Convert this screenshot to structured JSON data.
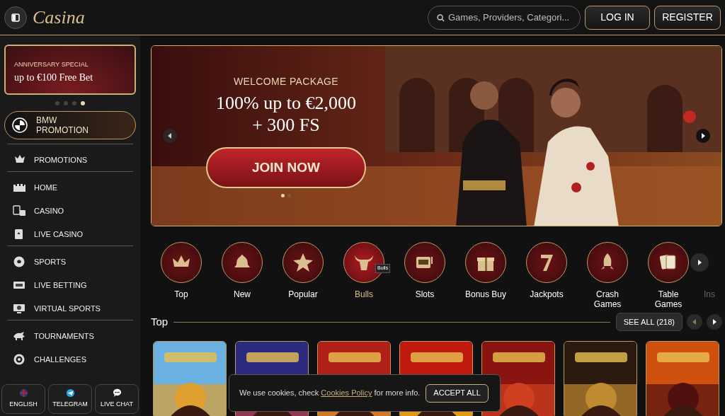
{
  "header": {
    "logo": "Casina",
    "search": {
      "placeholder": "Games, Providers, Categori..."
    },
    "buttons": [
      "LOG IN",
      "REGISTER"
    ]
  },
  "sidebar": {
    "promo": {
      "eyebrow": "ANNIVERSARY SPECIAL",
      "title": "up to €100 Free Bet"
    },
    "promo_dots": [
      {
        "selected": false
      },
      {
        "selected": false
      },
      {
        "selected": false
      },
      {
        "selected": true
      }
    ],
    "bmw": {
      "line_1": "BMW",
      "line_2": "PROMOTION"
    },
    "groups": [
      [
        {
          "label": "PROMOTIONS"
        }
      ],
      [
        {
          "label": "HOME"
        },
        {
          "label": "CASINO"
        },
        {
          "label": "LIVE CASINO"
        }
      ],
      [
        {
          "label": "SPORTS"
        },
        {
          "label": "LIVE BETTING"
        },
        {
          "label": "VIRTUAL SPORTS"
        }
      ],
      [
        {
          "label": "TOURNAMENTS"
        },
        {
          "label": "CHALLENGES"
        }
      ]
    ],
    "bottom_buttons": [
      {
        "label": "ENGLISH"
      },
      {
        "label": "TELEGRAM"
      },
      {
        "label": "LIVE CHAT"
      }
    ]
  },
  "banner": {
    "eyebrow": "WELCOME PACKAGE",
    "headline_1": "100% up to €2,000",
    "headline_2": "+ 300 FS",
    "cta": "JOIN NOW",
    "dots": [
      {
        "selected": true
      },
      {
        "selected": false
      }
    ]
  },
  "categories": [
    {
      "label": "Top",
      "selected": false
    },
    {
      "label": "New",
      "selected": false
    },
    {
      "label": "Popular",
      "selected": false
    },
    {
      "label": "Bulls",
      "selected": true,
      "tooltip": "Bulls"
    },
    {
      "label": "Slots",
      "selected": false
    },
    {
      "label": "Bonus Buy",
      "selected": false
    },
    {
      "label": "Jackpots",
      "selected": false
    },
    {
      "label": "Crash Games",
      "selected": false
    },
    {
      "label": "Table Games",
      "selected": false
    },
    {
      "label": "Ins",
      "selected": false
    }
  ],
  "section": {
    "title": "Top",
    "see_all": "SEE ALL (218)"
  },
  "cookie": {
    "text_before": "We use cookies, check ",
    "link": "Cookies Policy",
    "text_after": " for more info.",
    "button": "ACCEPT ALL"
  }
}
